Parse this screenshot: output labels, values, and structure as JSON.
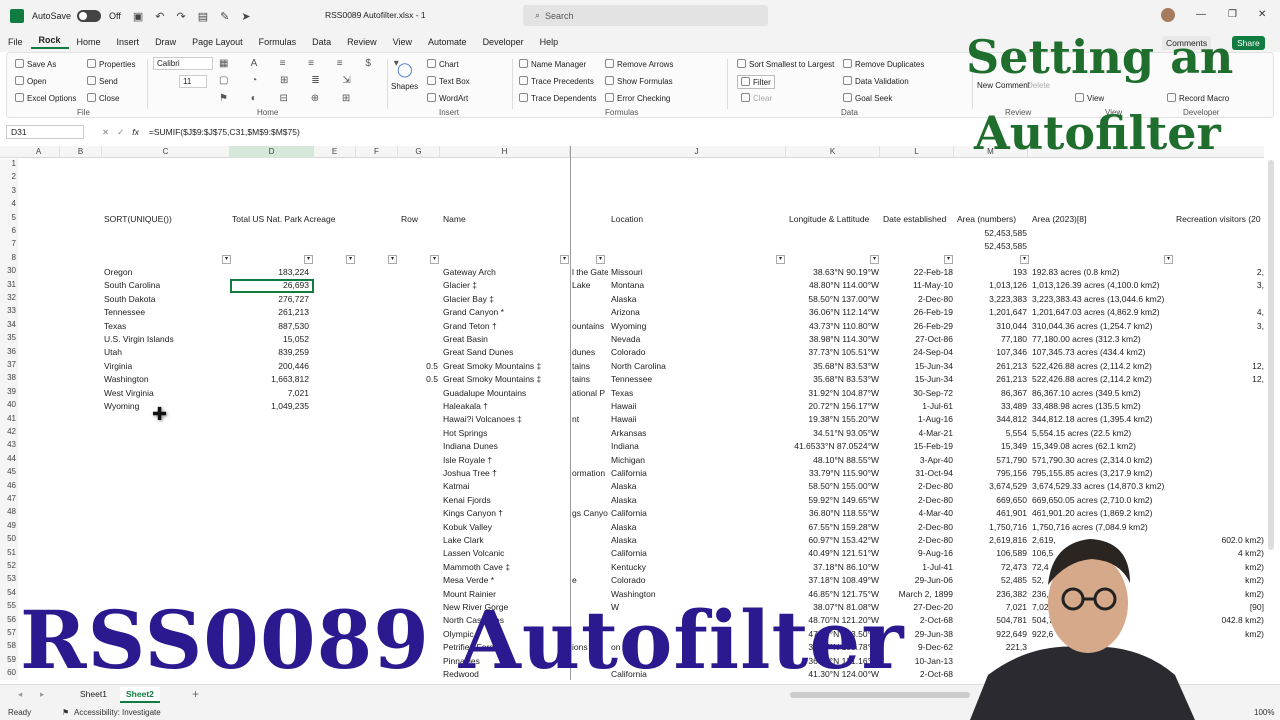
{
  "titlebar": {
    "autosave": "AutoSave",
    "autosave_state": "Off",
    "filename": "RSS0089 Autofilter.xlsx - 1",
    "search": "Search"
  },
  "menus": [
    "File",
    "Rock",
    "Home",
    "Insert",
    "Draw",
    "Page Layout",
    "Formulas",
    "Data",
    "Review",
    "View",
    "Automate",
    "Developer",
    "Help"
  ],
  "share": {
    "comments": "Comments",
    "share": "Share"
  },
  "ribbon": {
    "rock": [
      "Save As",
      "Open",
      "Excel Options",
      "Properties",
      "Send",
      "Close"
    ],
    "home": {
      "font": "Calibri",
      "size": "11"
    },
    "insert": [
      "Chart",
      "Text Box",
      "WordArt",
      "Shapes"
    ],
    "formulas": [
      "Name Manager",
      "Trace Precedents",
      "Trace Dependents",
      "Remove Arrows",
      "Show Formulas",
      "Error Checking"
    ],
    "data": [
      "Sort Smallest to Largest",
      "Filter",
      "Clear",
      "Remove Duplicates",
      "Data Validation",
      "Goal Seek"
    ],
    "review": [
      "New Comment",
      "Delete"
    ],
    "view": [
      "View"
    ],
    "developer": [
      "Record Macro"
    ],
    "groups": [
      "File",
      "Home",
      "Insert",
      "Formulas",
      "Data",
      "Review",
      "View",
      "Developer"
    ]
  },
  "formula": {
    "namebox": "D31",
    "fx": "fx",
    "text": "=SUMIF($J$9:$J$75,C31,$M$9:$M$75)"
  },
  "columns": [
    "A",
    "B",
    "C",
    "D",
    "E",
    "F",
    "G",
    "H",
    "J",
    "K",
    "L",
    "M"
  ],
  "headers": {
    "c": "SORT(UNIQUE())",
    "d": "Total US Nat. Park Acreage",
    "g": "Row",
    "h": "Name",
    "j": "Location",
    "k": "Longitude & Lattitude",
    "l": "Date established",
    "m": "Area (numbers)",
    "n": "Area (2023)[8]",
    "o": "Recreation visitors (20"
  },
  "m6": "52,453,585",
  "m7": "52,453,585",
  "row_numbers": [
    "1",
    "2",
    "3",
    "4",
    "5",
    "6",
    "7",
    "8",
    "30",
    "31",
    "32",
    "33",
    "34",
    "35",
    "36",
    "37",
    "38",
    "39",
    "40",
    "41",
    "42",
    "43",
    "44",
    "45",
    "46",
    "47",
    "48",
    "49",
    "50",
    "51",
    "52",
    "53",
    "54",
    "55",
    "56",
    "57",
    "58",
    "59",
    "60"
  ],
  "states": [
    [
      "Oregon",
      "183,224"
    ],
    [
      "South Carolina",
      "26,693"
    ],
    [
      "South Dakota",
      "276,727"
    ],
    [
      "Tennessee",
      "261,213"
    ],
    [
      "Texas",
      "887,530"
    ],
    [
      "U.S. Virgin Islands",
      "15,052"
    ],
    [
      "Utah",
      "839,259"
    ],
    [
      "Virginia",
      "200,446"
    ],
    [
      "Washington",
      "1,663,812"
    ],
    [
      "West Virginia",
      "7,021"
    ],
    [
      "Wyoming",
      "1,049,235"
    ]
  ],
  "parks": [
    [
      "",
      "Gateway Arch",
      "l the Gate",
      "Missouri",
      "38.63°N 90.19°W",
      "22-Feb-18",
      "193",
      "192.83 acres (0.8 km2)",
      "2,"
    ],
    [
      "",
      "Glacier ‡",
      "Lake",
      "Montana",
      "48.80°N 114.00°W",
      "11-May-10",
      "1,013,126",
      "1,013,126.39 acres (4,100.0 km2)",
      "3,"
    ],
    [
      "",
      "Glacier Bay ‡",
      "",
      "Alaska",
      "58.50°N 137.00°W",
      "2-Dec-80",
      "3,223,383",
      "3,223,383.43 acres (13,044.6 km2)",
      ""
    ],
    [
      "",
      "Grand Canyon *",
      "",
      "Arizona",
      "36.06°N 112.14°W",
      "26-Feb-19",
      "1,201,647",
      "1,201,647.03 acres (4,862.9 km2)",
      "4,"
    ],
    [
      "",
      "Grand Teton †",
      "ountains",
      "Wyoming",
      "43.73°N 110.80°W",
      "26-Feb-29",
      "310,044",
      "310,044.36 acres (1,254.7 km2)",
      "3,"
    ],
    [
      "",
      "Great Basin",
      "",
      "Nevada",
      "38.98°N 114.30°W",
      "27-Oct-86",
      "77,180",
      "77,180.00 acres (312.3 km2)",
      ""
    ],
    [
      "",
      "Great Sand Dunes",
      "dunes",
      "Colorado",
      "37.73°N 105.51°W",
      "24-Sep-04",
      "107,346",
      "107,345.73 acres (434.4 km2)",
      ""
    ],
    [
      "0.5",
      "Great Smoky Mountains ‡",
      "tains",
      "North Carolina",
      "35.68°N 83.53°W",
      "15-Jun-34",
      "261,213",
      "522,426.88 acres (2,114.2 km2)",
      "12,"
    ],
    [
      "0.5",
      "Great Smoky Mountains ‡",
      "tains",
      "Tennessee",
      "35.68°N 83.53°W",
      "15-Jun-34",
      "261,213",
      "522,426.88 acres (2,114.2 km2)",
      "12,"
    ],
    [
      "",
      "Guadalupe Mountains",
      "ational P",
      "Texas",
      "31.92°N 104.87°W",
      "30-Sep-72",
      "86,367",
      "86,367.10 acres (349.5 km2)",
      ""
    ],
    [
      "",
      "Haleakala †",
      "",
      "Hawaii",
      "20.72°N 156.17°W",
      "1-Jul-61",
      "33,489",
      "33,488.98 acres (135.5 km2)",
      ""
    ],
    [
      "",
      "Hawai?i Volcanoes ‡",
      "nt",
      "Hawaii",
      "19.38°N 155.20°W",
      "1-Aug-16",
      "344,812",
      "344,812.18 acres (1,395.4 km2)",
      ""
    ],
    [
      "",
      "Hot Springs",
      "",
      "Arkansas",
      "34.51°N 93.05°W",
      "4-Mar-21",
      "5,554",
      "5,554.15 acres (22.5 km2)",
      ""
    ],
    [
      "",
      "Indiana Dunes",
      "",
      "Indiana",
      "41.6533°N 87.0524°W",
      "15-Feb-19",
      "15,349",
      "15,349.08 acres (62.1 km2)",
      ""
    ],
    [
      "",
      "Isle Royale †",
      "",
      "Michigan",
      "48.10°N 88.55°W",
      "3-Apr-40",
      "571,790",
      "571,790.30 acres (2,314.0 km2)",
      ""
    ],
    [
      "",
      "Joshua Tree †",
      "ormation",
      "California",
      "33.79°N 115.90°W",
      "31-Oct-94",
      "795,156",
      "795,155.85 acres (3,217.9 km2)",
      ""
    ],
    [
      "",
      "Katmai",
      "",
      "Alaska",
      "58.50°N 155.00°W",
      "2-Dec-80",
      "3,674,529",
      "3,674,529.33 acres (14,870.3 km2)",
      ""
    ],
    [
      "",
      "Kenai Fjords",
      "",
      "Alaska",
      "59.92°N 149.65°W",
      "2-Dec-80",
      "669,650",
      "669,650.05 acres (2,710.0 km2)",
      ""
    ],
    [
      "",
      "Kings Canyon †",
      "gs Canyon",
      "California",
      "36.80°N 118.55°W",
      "4-Mar-40",
      "461,901",
      "461,901.20 acres (1,869.2 km2)",
      ""
    ],
    [
      "",
      "Kobuk Valley",
      "",
      "Alaska",
      "67.55°N 159.28°W",
      "2-Dec-80",
      "1,750,716",
      "1,750,716 acres (7,084.9 km2)",
      ""
    ],
    [
      "",
      "Lake Clark",
      "",
      "Alaska",
      "60.97°N 153.42°W",
      "2-Dec-80",
      "2,619,816",
      "2,619,",
      "602.0 km2)"
    ],
    [
      "",
      "Lassen Volcanic",
      "",
      "California",
      "40.49°N 121.51°W",
      "9-Aug-16",
      "106,589",
      "106,5",
      "4 km2)"
    ],
    [
      "",
      "Mammoth Cave ‡",
      "",
      "Kentucky",
      "37.18°N 86.10°W",
      "1-Jul-41",
      "72,473",
      "72,4",
      "km2)"
    ],
    [
      "",
      "Mesa Verde *",
      "e",
      "Colorado",
      "37.18°N 108.49°W",
      "29-Jun-06",
      "52,485",
      "52,",
      "km2)"
    ],
    [
      "",
      "Mount Rainier",
      "",
      "Washington",
      "46.85°N 121.75°W",
      "March 2, 1899",
      "236,382",
      "236,",
      "km2)"
    ],
    [
      "",
      "New River Gorge",
      "",
      "W",
      "38.07°N 81.08°W",
      "27-Dec-20",
      "7,021",
      "7,02",
      "[90]"
    ],
    [
      "",
      "North Cascades",
      "",
      "",
      "48.70°N 121.20°W",
      "2-Oct-68",
      "504,781",
      "504,7",
      "042.8 km2)"
    ],
    [
      "",
      "Olympic",
      "",
      "",
      "47.97°N 123.50°W",
      "29-Jun-38",
      "922,649",
      "922,6",
      "km2)"
    ],
    [
      "",
      "Petrified Forest",
      "ions",
      "on",
      "35.07°N 109.78°W",
      "9-Dec-62",
      "221,3",
      "",
      ""
    ],
    [
      "",
      "Pinnacles",
      "",
      "",
      "36.48°N 121.16°W",
      "10-Jan-13",
      "",
      "",
      ""
    ],
    [
      "",
      "Redwood",
      "",
      "California",
      "41.30°N 124.00°W",
      "2-Oct-68",
      "",
      "",
      ""
    ]
  ],
  "sheets": [
    "Sheet1",
    "Sheet2"
  ],
  "status": {
    "ready": "Ready",
    "accessibility": "Accessibility: Investigate",
    "zoom": "100%"
  },
  "overlay": {
    "line1": "Setting an",
    "line2": "Autofilter",
    "big": "RSS0089 Autofilter"
  },
  "colors": {
    "excel_green": "#107c41",
    "overlay_green": "#1f6e2d",
    "overlay_purple": "#2b1a8f"
  }
}
